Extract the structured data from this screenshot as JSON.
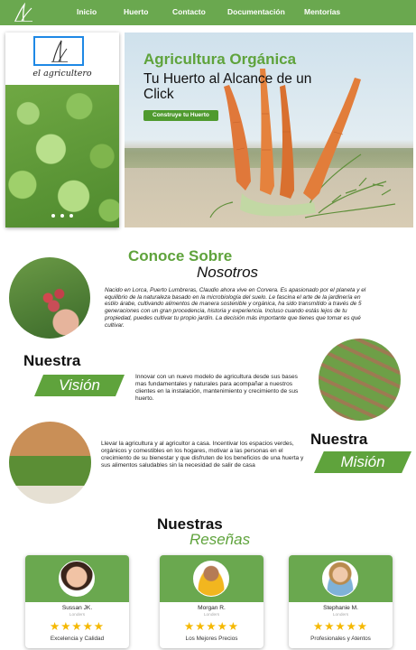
{
  "nav": {
    "logo_icon": "leaf-logo-icon",
    "items": [
      {
        "label": "Inicio"
      },
      {
        "label": "Huerto"
      },
      {
        "label": "Contacto"
      },
      {
        "label": "Documentación"
      },
      {
        "label": "Mentorías"
      }
    ]
  },
  "hero": {
    "brand_name": "el agricultero",
    "carousel_dots": 3,
    "title": "Agricultura Orgánica",
    "subtitle": "Tu Huerto al Alcance de un Click",
    "cta_label": "Construye tu Huerto"
  },
  "about": {
    "title": "Conoce Sobre",
    "subtitle": "Nosotros",
    "text": "Nacido en Lorca, Puerto Lumbreras, Claudio ahora vive en Corvera. Es apasionado por el planeta y el equilibrio de la naturaleza basado en la microbiología del suelo. Le fascina el arte de la jardinería en estilo árabe, cultivando alimentos de manera sostenible y orgánica, ha sido transmitido a través de 5 generaciones con un gran procedencia, historia y experiencia. Incluso cuando estás lejos de tu propiedad, puedes cultivar tu propio jardín. La decisión más importante que tienes que tomar es qué cultivar."
  },
  "vision": {
    "heading": "Nuestra",
    "ribbon": "Visión",
    "text": "Innovar con un nuevo modelo de agricultura desde sus bases mas fundamentales y naturales para acompañar a nuestros clientes en la instalación,  mantenimiento y crecimiento de sus huerto."
  },
  "mission": {
    "heading": "Nuestra",
    "ribbon": "Misión",
    "text": "Llevar la agricultura y al agricultor a casa. Incentivar los espacios verdes, orgánicos y comestibles en los hogares, motivar a las personas en el crecimiento de su bienestar y que disfruten de los beneficios de una huerta y sus alimentos saludables sin la necesidad de salir de casa"
  },
  "reviews": {
    "heading": "Nuestras",
    "subheading": "Reseñas",
    "items": [
      {
        "name": "Sussan JK.",
        "role": "Londers",
        "stars": "★★★★★",
        "rating": 5,
        "quote": "Excelencia y Calidad"
      },
      {
        "name": "Morgan R.",
        "role": "Londers",
        "stars": "★★★★★",
        "rating": 5,
        "quote": "Los Mejores Precios"
      },
      {
        "name": "Stephanie M.",
        "role": "Londers",
        "stars": "★★★★★",
        "rating": 5,
        "quote": "Profesionales y Atentos"
      }
    ]
  },
  "colors": {
    "brand_green": "#6aa84f",
    "accent_green": "#5fa33c",
    "star": "#f5b800"
  }
}
